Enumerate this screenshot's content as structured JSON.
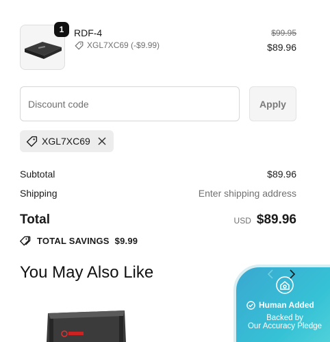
{
  "line_item": {
    "quantity": "1",
    "name": "RDF-4",
    "discount_code": "XGL7XC69 (-$9.99)",
    "compare_price": "$99.95",
    "final_price": "$89.96",
    "image_icon": "amplifier-image"
  },
  "discount": {
    "placeholder": "Discount code",
    "value": "",
    "apply_label": "Apply",
    "applied_code": "XGL7XC69",
    "remove_icon": "close-icon"
  },
  "summary": {
    "subtotal_label": "Subtotal",
    "subtotal_value": "$89.96",
    "shipping_label": "Shipping",
    "shipping_value": "Enter shipping address",
    "total_label": "Total",
    "currency": "USD",
    "total_value": "$89.96",
    "savings_label": "TOTAL SAVINGS",
    "savings_value": "$9.99"
  },
  "recommendations": {
    "title": "You May Also Like"
  },
  "trust_badge": {
    "title": "Human Added",
    "line1": "Backed by",
    "line2": "Our Accuracy Pledge"
  },
  "colors": {
    "badge_gradient_start": "#3aa8d0",
    "badge_gradient_end": "#58d6db",
    "chip_bg": "#ededed"
  }
}
